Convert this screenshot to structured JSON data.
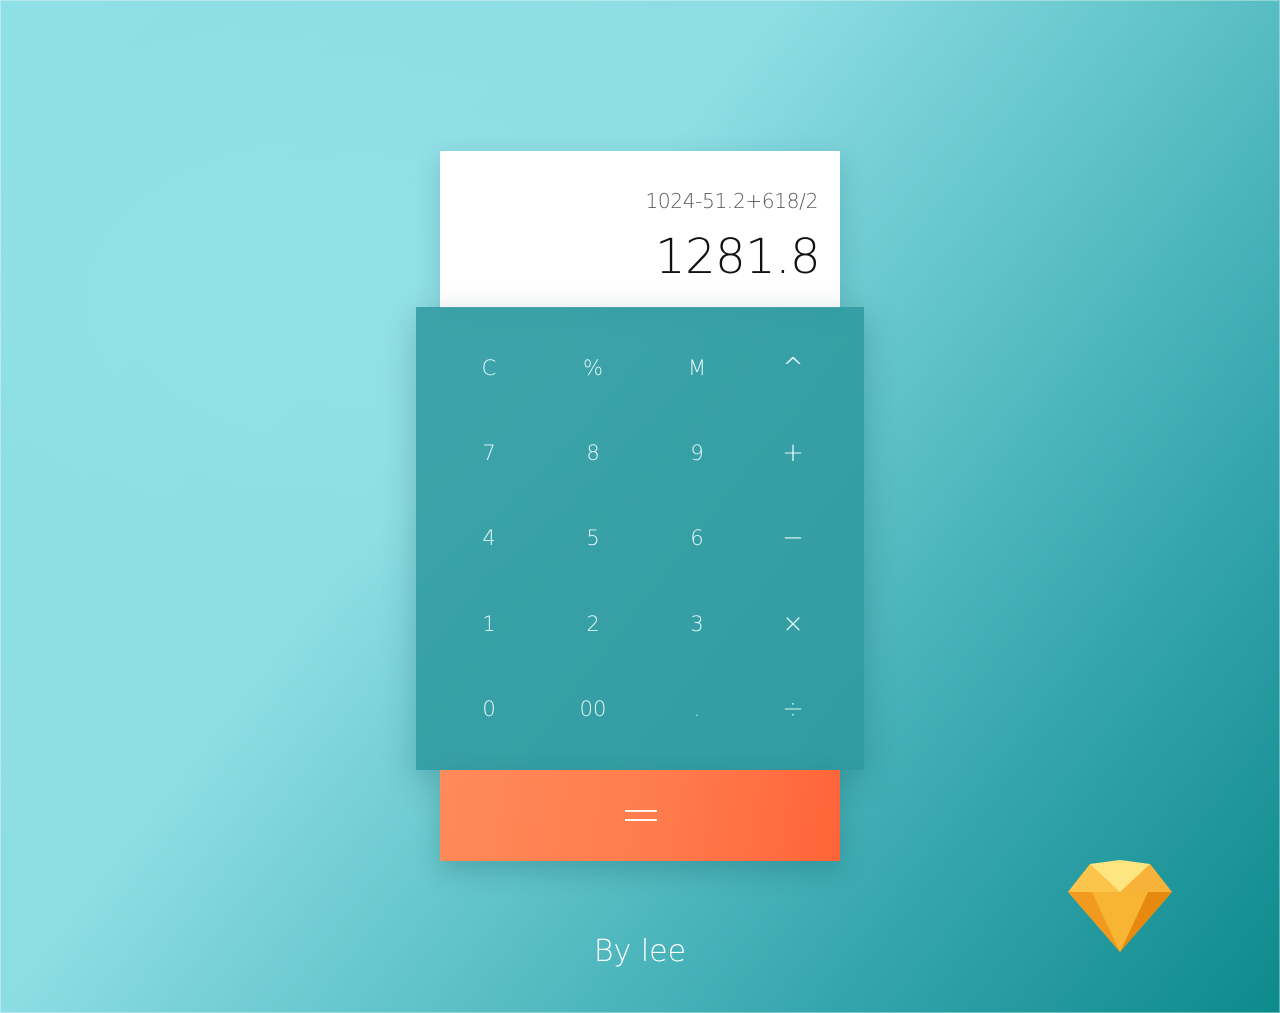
{
  "display": {
    "expression": "1024-51.2+618/2",
    "result": "1281.8"
  },
  "keypad": {
    "rows": [
      [
        {
          "name": "clear-key",
          "label": "C"
        },
        {
          "name": "percent-key",
          "label": "%"
        },
        {
          "name": "memory-key",
          "label": "M"
        },
        {
          "name": "power-key",
          "label": "^"
        }
      ],
      [
        {
          "name": "digit-7-key",
          "label": "7"
        },
        {
          "name": "digit-8-key",
          "label": "8"
        },
        {
          "name": "digit-9-key",
          "label": "9"
        },
        {
          "name": "plus-key",
          "label": "+"
        }
      ],
      [
        {
          "name": "digit-4-key",
          "label": "4"
        },
        {
          "name": "digit-5-key",
          "label": "5"
        },
        {
          "name": "digit-6-key",
          "label": "6"
        },
        {
          "name": "minus-key",
          "label": "−"
        }
      ],
      [
        {
          "name": "digit-1-key",
          "label": "1"
        },
        {
          "name": "digit-2-key",
          "label": "2"
        },
        {
          "name": "digit-3-key",
          "label": "3"
        },
        {
          "name": "multiply-key",
          "label": "×"
        }
      ],
      [
        {
          "name": "digit-0-key",
          "label": "0"
        },
        {
          "name": "double-zero-key",
          "label": "00"
        },
        {
          "name": "decimal-key",
          "label": "."
        },
        {
          "name": "divide-key",
          "label": "÷"
        }
      ]
    ]
  },
  "equals_icon": "equals-icon",
  "byline": "By lee",
  "logo_icon": "sketch-diamond-icon",
  "colors": {
    "accent": "#ff7b4c",
    "keypad": "#2d989e",
    "display_bg": "#ffffff"
  }
}
